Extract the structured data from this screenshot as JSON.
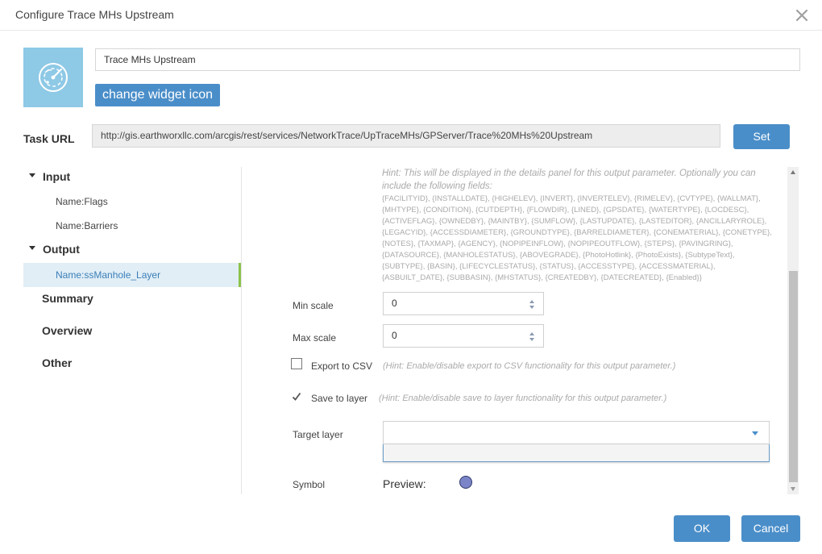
{
  "dialog": {
    "title": "Configure Trace MHs Upstream"
  },
  "widget": {
    "name_value": "Trace MHs Upstream",
    "change_icon_label": "change widget icon",
    "icon": "radar-trace-icon",
    "icon_bg": "#8ec9e6"
  },
  "task": {
    "label": "Task URL",
    "url": "http://gis.earthworxllc.com/arcgis/rest/services/NetworkTrace/UpTraceMHs/GPServer/Trace%20MHs%20Upstream",
    "set_label": "Set"
  },
  "tree": {
    "input": {
      "label": "Input",
      "items": [
        "Name:Flags",
        "Name:Barriers"
      ]
    },
    "output": {
      "label": "Output",
      "items": [
        "Name:ssManhole_Layer"
      ]
    },
    "others": [
      "Summary",
      "Overview",
      "Other"
    ]
  },
  "panel": {
    "hint_text": "Hint: This will be displayed in the details panel for this output parameter. Optionally you can include the following fields:",
    "fields_text": "{FACILITYID}, {INSTALLDATE}, {HIGHELEV}, {INVERT}, {INVERTELEV}, {RIMELEV}, {CVTYPE}, {WALLMAT}, {MHTYPE}, {CONDITION}, {CUTDEPTH}, {FLOWDIR}, {LINED}, {GPSDATE}, {WATERTYPE}, {LOCDESC}, {ACTIVEFLAG}, {OWNEDBY}, {MAINTBY}, {SUMFLOW}, {LASTUPDATE}, {LASTEDITOR}, {ANCILLARYROLE}, {LEGACYID}, {ACCESSDIAMETER}, {GROUNDTYPE}, {BARRELDIAMETER}, {CONEMATERIAL}, {CONETYPE}, {NOTES}, {TAXMAP}, {AGENCY}, {NOPIPEINFLOW}, {NOPIPEOUTFLOW}, {STEPS}, {PAVINGRING}, {DATASOURCE}, {MANHOLESTATUS}, {ABOVEGRADE}, {PhotoHotlink}, {PhotoExists}, {SubtypeText}, {SUBTYPE}, {BASIN}, {LIFECYCLESTATUS}, {STATUS}, {ACCESSTYPE}, {ACCESSMATERIAL}, {ASBUILT_DATE}, {SUBBASIN}, {MHSTATUS}, {CREATEDBY}, {DATECREATED}, {Enabled}}",
    "min_scale_label": "Min scale",
    "min_scale_value": "0",
    "max_scale_label": "Max scale",
    "max_scale_value": "0",
    "export_csv_label": "Export to CSV",
    "export_csv_checked": false,
    "export_csv_hint": "(Hint: Enable/disable export to CSV functionality for this output parameter.)",
    "save_layer_label": "Save to layer",
    "save_layer_checked": true,
    "save_layer_hint": "(Hint: Enable/disable save to layer functionality for this output parameter.)",
    "target_layer_label": "Target layer",
    "target_layer_value": "",
    "symbol_label": "Symbol",
    "preview_label": "Preview:",
    "symbol_fill": "#7b84c7",
    "symbol_outline": "#2d3a6b"
  },
  "footer": {
    "ok_label": "OK",
    "cancel_label": "Cancel"
  },
  "colors": {
    "accent": "#4a8ec9",
    "selected_bg": "#e1eef6",
    "selected_marker": "#8bc34a"
  }
}
